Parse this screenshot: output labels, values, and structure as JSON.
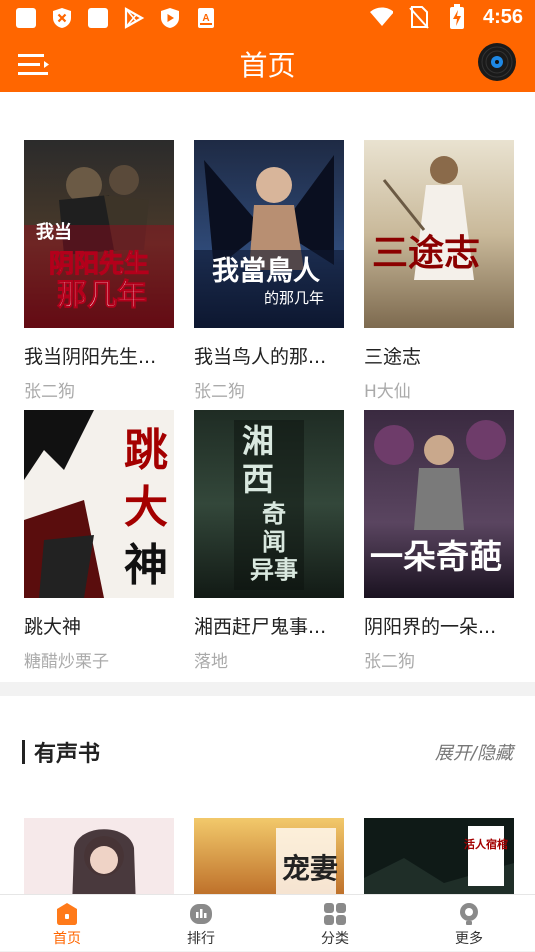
{
  "status_bar": {
    "time": "4:56"
  },
  "app_bar": {
    "title": "首页"
  },
  "featured_books": [
    {
      "title": "我当阴阳先生...",
      "author": "张二狗",
      "cover_text": "我当阴阳先生那几年"
    },
    {
      "title": "我当鸟人的那...",
      "author": "张二狗",
      "cover_text": "我當鳥人的那几年"
    },
    {
      "title": "三途志",
      "author": "H大仙",
      "cover_text": "三途志"
    },
    {
      "title": "跳大神",
      "author": "糖醋炒栗子",
      "cover_text": "跳大神"
    },
    {
      "title": "湘西赶尸鬼事...",
      "author": "落地",
      "cover_text": "湘西奇闻异事"
    },
    {
      "title": "阴阳界的一朵...",
      "author": "张二狗",
      "cover_text": "一朵奇葩"
    }
  ],
  "audio_section": {
    "title": "有声书",
    "toggle": "展开/隐藏",
    "cover_texts": [
      "",
      "宠妻",
      "活人宿棺"
    ]
  },
  "tabs": [
    {
      "label": "首页",
      "icon": "home-icon"
    },
    {
      "label": "排行",
      "icon": "ranking-icon"
    },
    {
      "label": "分类",
      "icon": "category-icon"
    },
    {
      "label": "更多",
      "icon": "more-icon"
    }
  ],
  "colors": {
    "accent": "#ff6600",
    "background": "#f2f2f2"
  }
}
